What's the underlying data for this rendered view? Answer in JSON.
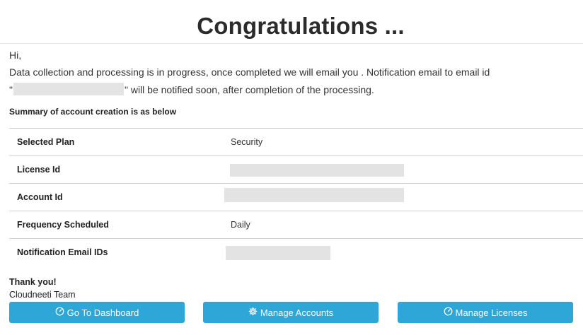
{
  "header": {
    "title": "Congratulations ..."
  },
  "message": {
    "greeting": "Hi,",
    "line1": "Data collection and processing is in progress, once completed we will email you . Notification email to email id",
    "line2_prefix": "\"",
    "line2_suffix": "\" will be notified soon, after completion of the processing."
  },
  "summary": {
    "heading": "Summary of account creation is as below",
    "rows": [
      {
        "label": "Selected Plan",
        "value": "Security"
      },
      {
        "label": "License Id",
        "value": ""
      },
      {
        "label": "Account Id",
        "value": ""
      },
      {
        "label": "Frequency Scheduled",
        "value": "Daily"
      },
      {
        "label": "Notification Email IDs",
        "value": ""
      }
    ]
  },
  "footer": {
    "thanks": "Thank you!",
    "team": "Cloudneeti Team"
  },
  "buttons": {
    "dashboard": "Go To Dashboard",
    "accounts": "Manage Accounts",
    "licenses": "Manage Licenses"
  },
  "icons": {
    "dashboard": "gauge-icon",
    "accounts": "gear-icon",
    "licenses": "gauge-icon"
  },
  "colors": {
    "button": "#2ea7d8",
    "redaction": "#e3e3e3"
  }
}
